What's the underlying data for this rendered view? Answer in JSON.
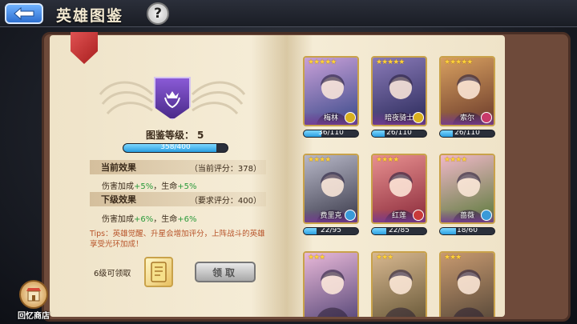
{
  "header": {
    "title": "英雄图鉴",
    "back_icon": "back-arrow-icon",
    "help_glyph": "?"
  },
  "codex": {
    "level_label": "图鉴等级：",
    "level_value": "5",
    "progress_text": "358/400",
    "progress_fraction": 0.895,
    "current_effect": {
      "title": "当前效果",
      "score": "（当前评分：378）",
      "stats_prefix": "伤害加成",
      "stats_val1": "+5%",
      "stats_mid": "，生命",
      "stats_val2": "+5%"
    },
    "next_effect": {
      "title": "下级效果",
      "score": "（要求评分：400）",
      "stats_prefix": "伤害加成",
      "stats_val1": "+6%",
      "stats_mid": "，生命",
      "stats_val2": "+6%"
    },
    "tips": "Tips：英雄觉醒、升星会增加评分，上阵战斗的英雄享受光环加成！",
    "claim_label": "6级可领取",
    "claim_button": "领取"
  },
  "shop": {
    "label": "回忆商店"
  },
  "colors": {
    "accent_blue": "#2a9ee0",
    "tips_orange": "#b8542a",
    "bonus_green": "#2a9a3a"
  },
  "heroes": [
    {
      "name": "梅林",
      "stars": "★★★★★",
      "progress": "36/110",
      "fraction": 0.33,
      "bg1": "#3a4a8a",
      "bg2": "#c9a0d8",
      "badge": "#d8b020"
    },
    {
      "name": "暗夜骑士",
      "stars": "★★★★★",
      "progress": "26/110",
      "fraction": 0.24,
      "bg1": "#2a2a5a",
      "bg2": "#8a7ab8",
      "badge": "#d8b020"
    },
    {
      "name": "索尔",
      "stars": "★★★★★",
      "progress": "26/110",
      "fraction": 0.24,
      "bg1": "#6a3a2a",
      "bg2": "#d8a060",
      "badge": "#c83a6a"
    },
    {
      "name": "费里克",
      "stars": "★★★★",
      "progress": "22/95",
      "fraction": 0.23,
      "bg1": "#3a3a4a",
      "bg2": "#b8b8c8",
      "badge": "#3a9ad8"
    },
    {
      "name": "红莲",
      "stars": "★★★★",
      "progress": "22/85",
      "fraction": 0.26,
      "bg1": "#8a2a3a",
      "bg2": "#e89090",
      "badge": "#c83a3a"
    },
    {
      "name": "蔷薇",
      "stars": "★★★★",
      "progress": "18/60",
      "fraction": 0.3,
      "bg1": "#5a7a3a",
      "bg2": "#f0b8c8",
      "badge": "#3a9ad8"
    },
    {
      "name": "",
      "stars": "★★★",
      "progress": "",
      "fraction": 0,
      "bg1": "#5a4a7a",
      "bg2": "#e8b8d8",
      "badge": "#3a9ad8"
    },
    {
      "name": "",
      "stars": "★★★",
      "progress": "",
      "fraction": 0,
      "bg1": "#6a5a3a",
      "bg2": "#d8b890",
      "badge": "#3a9ad8"
    },
    {
      "name": "",
      "stars": "★★★",
      "progress": "",
      "fraction": 0,
      "bg1": "#5a4a3a",
      "bg2": "#c89a70",
      "badge": "#3a9ad8"
    }
  ]
}
